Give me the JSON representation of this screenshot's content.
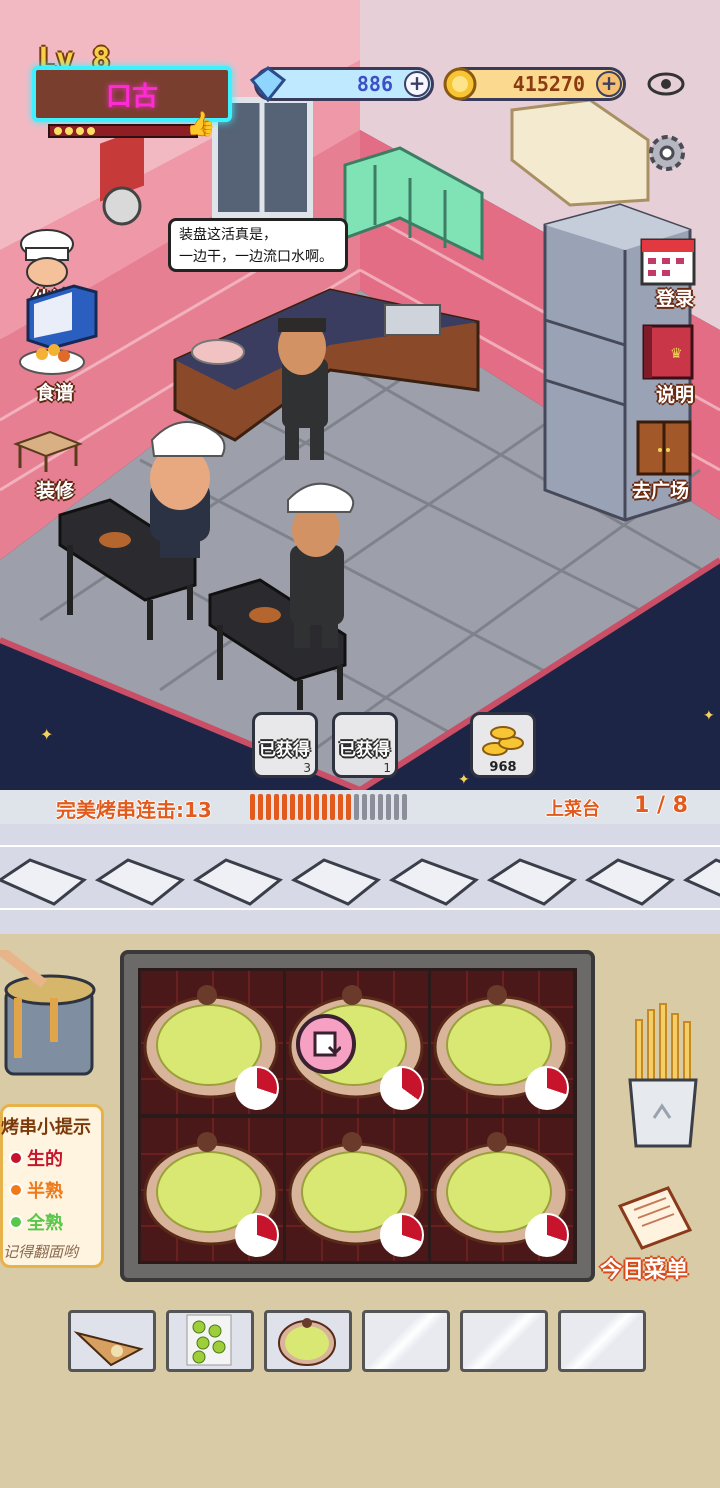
{
  "player": {
    "level_label": "Lv 8",
    "name": "口古"
  },
  "currency": {
    "diamonds": "886",
    "coins": "415270"
  },
  "side_menu_left": [
    {
      "label": "伙计",
      "icon": "chef-hat-icon"
    },
    {
      "label": "食谱",
      "icon": "skewer-plate-icon"
    },
    {
      "label": "装修",
      "icon": "table-icon"
    }
  ],
  "side_menu_right": [
    {
      "label": "登录",
      "icon": "calendar-icon"
    },
    {
      "label": "说明",
      "icon": "book-icon"
    },
    {
      "label": "去广场",
      "icon": "door-icon"
    }
  ],
  "speech": {
    "line1": "装盘这活真是，",
    "line2": "一边干，一边流口水啊。"
  },
  "rewards": [
    {
      "label": "已获得",
      "count": "3"
    },
    {
      "label": "已获得",
      "count": "1"
    },
    {
      "label": "",
      "count": "968"
    }
  ],
  "combo": {
    "label": "完美烤串连击:13",
    "filled_segments": 13,
    "total_segments": 20
  },
  "serving_counter": {
    "label": "上菜台",
    "progress": "1 / 8"
  },
  "tips": {
    "title": "烤串小提示",
    "raw": "生的",
    "half": "半熟",
    "done": "全熟",
    "note": "记得翻面哟"
  },
  "today_menu": {
    "label": "今日菜单"
  },
  "colors": {
    "raw": "#c8132c",
    "half": "#f07a1a",
    "done": "#58c84a",
    "accent_orange": "#e25a1c",
    "neon_pink": "#ff2bd6",
    "neon_cyan": "#3ff0ff"
  },
  "grill_slots": [
    {
      "item": "bun-skewer",
      "cook_level": 0.3
    },
    {
      "item": "bun-skewer",
      "cook_level": 0.35
    },
    {
      "item": "bun-skewer",
      "cook_level": 0.3
    },
    {
      "item": "bun-skewer",
      "cook_level": 0.3
    },
    {
      "item": "bun-skewer",
      "cook_level": 0.3
    },
    {
      "item": "bun-skewer",
      "cook_level": 0.3
    }
  ],
  "inventory": [
    {
      "item": "grilled-fish-icon"
    },
    {
      "item": "green-peas-icon"
    },
    {
      "item": "bun-skewer-icon"
    },
    {
      "item": "empty"
    },
    {
      "item": "empty"
    },
    {
      "item": "empty"
    }
  ]
}
